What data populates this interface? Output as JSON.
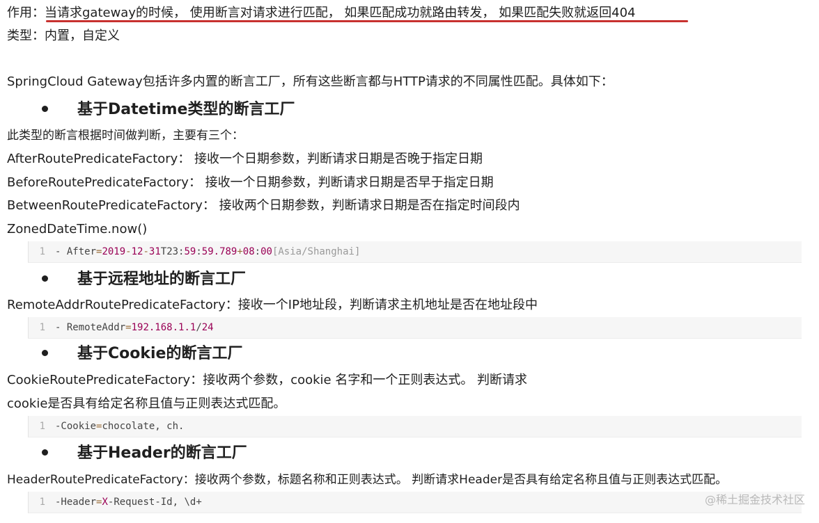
{
  "intro": {
    "label": "作用：",
    "underlined_text": "当请求gateway的时候， 使用断言对请求进行匹配， 如果匹配成功就路由转发， 如果匹配失败就返回404"
  },
  "type_line": "类型：内置，自定义",
  "overview": "SpringCloud Gateway包括许多内置的断言工厂，所有这些断言都与HTTP请求的不同属性匹配。具体如下：",
  "sections": {
    "datetime": {
      "heading": "基于Datetime类型的断言工厂",
      "desc": "此类型的断言根据时间做判断，主要有三个：",
      "after": "AfterRoutePredicateFactory： 接收一个日期参数，判断请求日期是否晚于指定日期",
      "before": "BeforeRoutePredicateFactory： 接收一个日期参数，判断请求日期是否早于指定日期",
      "between": "BetweenRoutePredicateFactory： 接收两个日期参数，判断请求日期是否在指定时间段内",
      "zoned": "ZonedDateTime.now()",
      "code": {
        "line_no": "1",
        "tokens": [
          "- After",
          "=",
          "2019",
          "-",
          "12",
          "-",
          "31",
          "T23:",
          "59",
          ":",
          "59.789",
          "+",
          "08",
          ":",
          "00",
          "[Asia/Shanghai]"
        ]
      }
    },
    "remote": {
      "heading": "基于远程地址的断言工厂",
      "desc": "RemoteAddrRoutePredicateFactory：接收一个IP地址段，判断请求主机地址是否在地址段中",
      "code": {
        "line_no": "1",
        "tokens": [
          "- RemoteAddr",
          "=",
          "192.168.1.1",
          "/",
          "24"
        ]
      }
    },
    "cookie": {
      "heading": "基于Cookie的断言工厂",
      "desc1": "CookieRoutePredicateFactory：接收两个参数，cookie 名字和一个正则表达式。 判断请求",
      "desc2": "cookie是否具有给定名称且值与正则表达式匹配。",
      "code": {
        "line_no": "1",
        "tokens": [
          "-Cookie",
          "=",
          "chocolate, ch."
        ]
      }
    },
    "header": {
      "heading": "基于Header的断言工厂",
      "desc": "HeaderRoutePredicateFactory：接收两个参数，标题名称和正则表达式。 判断请求Header是否具有给定名称且值与正则表达式匹配。",
      "code": {
        "line_no": "1",
        "tokens": [
          "-Header",
          "=",
          "X",
          "-Request-Id, \\d+"
        ]
      }
    }
  },
  "watermark": "@稀土掘金技术社区",
  "colors": {
    "underline": "#c8312f",
    "code_number": "#990055",
    "code_background": "#f6f6f6"
  }
}
